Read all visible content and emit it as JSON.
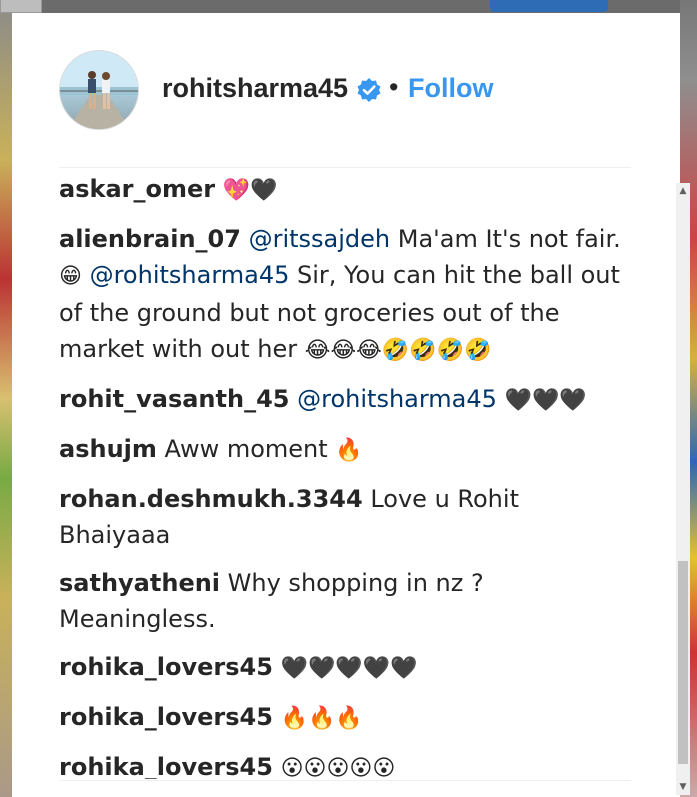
{
  "post": {
    "username": "rohitsharma45",
    "separator": "•",
    "follow_label": "Follow"
  },
  "comments": [
    {
      "user": "askar_omer",
      "parts": [
        {
          "t": "text",
          "v": " "
        },
        {
          "t": "emoji",
          "v": "💖🖤"
        }
      ]
    },
    {
      "user": "alienbrain_07",
      "parts": [
        {
          "t": "text",
          "v": " "
        },
        {
          "t": "mention",
          "v": "@ritssajdeh"
        },
        {
          "t": "text",
          "v": " Ma'am It's not fair. "
        },
        {
          "t": "emoji",
          "v": "😁"
        },
        {
          "t": "text",
          "v": " "
        },
        {
          "t": "mention",
          "v": "@rohitsharma45"
        },
        {
          "t": "text",
          "v": " Sir, You can hit the ball out of the ground but not groceries out of the market with out her "
        },
        {
          "t": "emoji",
          "v": "😂😂😂🤣🤣🤣🤣"
        }
      ]
    },
    {
      "user": "rohit_vasanth_45",
      "parts": [
        {
          "t": "text",
          "v": " "
        },
        {
          "t": "mention",
          "v": "@rohitsharma45"
        },
        {
          "t": "text",
          "v": " "
        },
        {
          "t": "emoji",
          "v": "🖤🖤🖤"
        }
      ]
    },
    {
      "user": "ashujm",
      "parts": [
        {
          "t": "text",
          "v": " Aww moment "
        },
        {
          "t": "emoji",
          "v": "🔥"
        }
      ]
    },
    {
      "user": "rohan.deshmukh.3344",
      "parts": [
        {
          "t": "text",
          "v": " Love u Rohit Bhaiyaaa"
        }
      ]
    },
    {
      "user": "sathyatheni",
      "parts": [
        {
          "t": "text",
          "v": " Why shopping in nz ? Meaningless."
        }
      ]
    },
    {
      "user": "rohika_lovers45",
      "parts": [
        {
          "t": "text",
          "v": " "
        },
        {
          "t": "emoji",
          "v": "🖤🖤🖤🖤🖤"
        }
      ]
    },
    {
      "user": "rohika_lovers45",
      "parts": [
        {
          "t": "text",
          "v": " "
        },
        {
          "t": "emoji",
          "v": "🔥🔥🔥"
        }
      ]
    },
    {
      "user": "rohika_lovers45",
      "parts": [
        {
          "t": "text",
          "v": " "
        },
        {
          "t": "emoji",
          "v": "😮😮😮😮😮"
        }
      ]
    }
  ],
  "icons": {
    "verified": "verified-badge-icon",
    "scroll_up": "▲",
    "scroll_down": "▼"
  },
  "colors": {
    "follow": "#3897f0",
    "verified": "#3897f0",
    "mention": "#003569",
    "text": "#262626"
  }
}
